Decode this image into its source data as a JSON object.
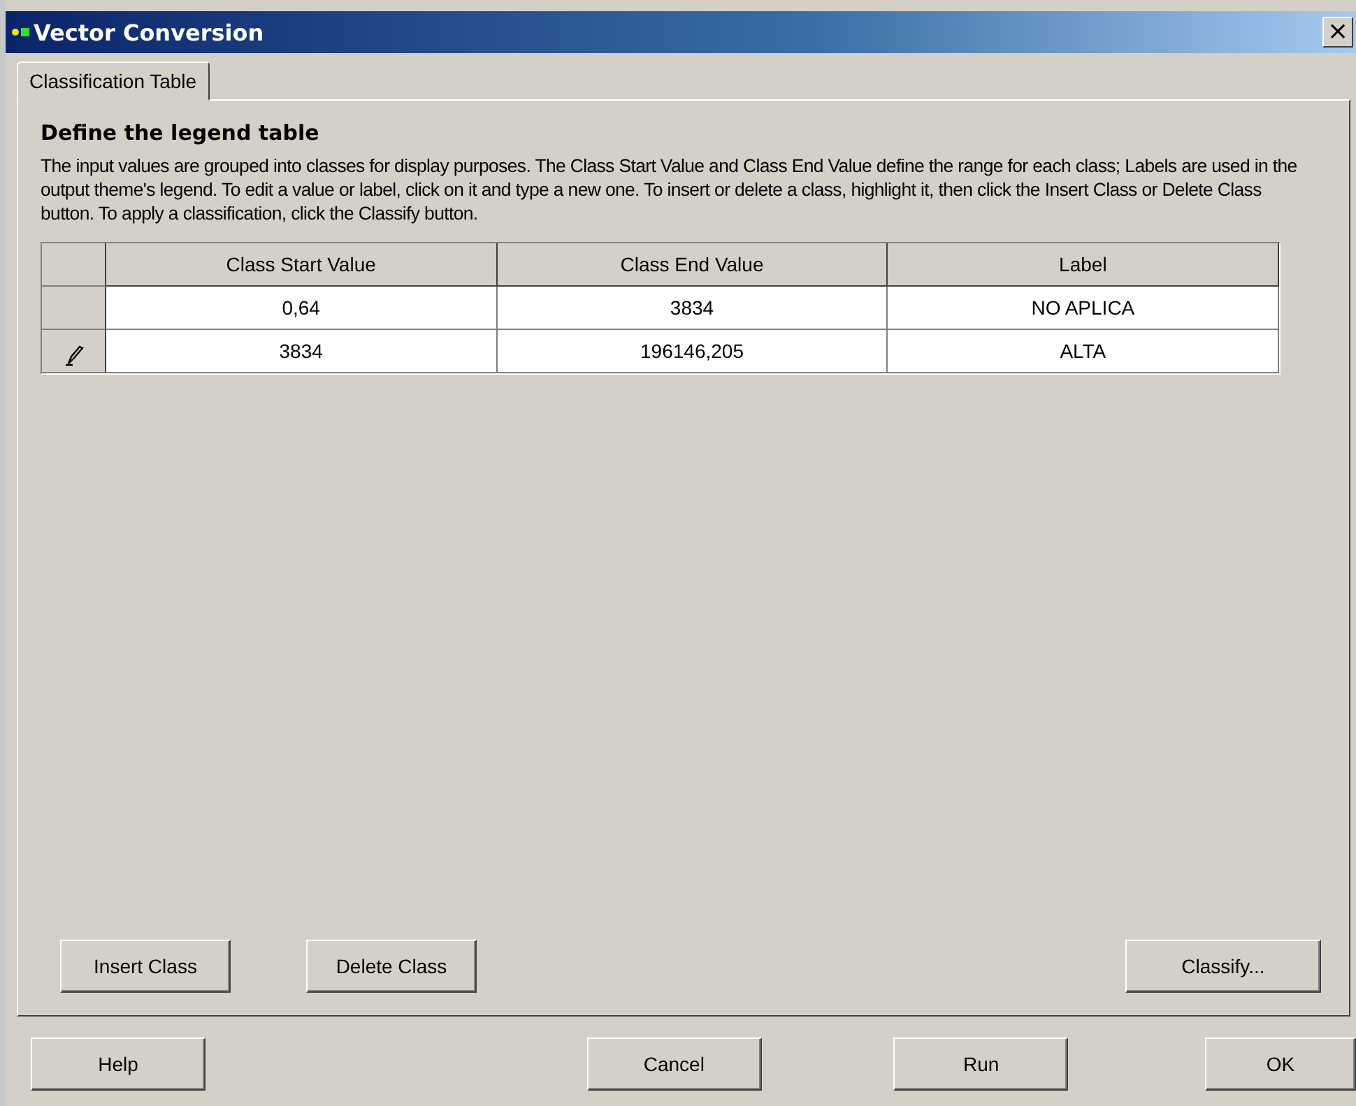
{
  "window": {
    "title": "Vector Conversion",
    "close": "×"
  },
  "tabs": [
    {
      "label": "Classification Table",
      "selected": true
    }
  ],
  "heading": "Define the legend table",
  "description": "The input values are grouped into classes for display purposes. The Class Start Value and Class End Value define the range for each class; Labels are used in the output theme's legend. To edit a value or label, click on it and type a new one. To insert or delete a class, highlight it, then click the Insert Class or Delete Class button. To apply a classification, click the Classify button.",
  "table": {
    "columns": [
      "Class Start Value",
      "Class End Value",
      "Label"
    ],
    "rows": [
      {
        "editing": false,
        "cells": [
          "0,64",
          "3834",
          "NO APLICA"
        ]
      },
      {
        "editing": true,
        "cells": [
          "3834",
          "196146,205",
          "ALTA"
        ]
      }
    ]
  },
  "panel_buttons_left": [
    "Insert Class",
    "Delete Class"
  ],
  "panel_buttons_right": [
    "Classify..."
  ],
  "dialog_buttons": [
    "Help",
    "Cancel",
    "Run",
    "OK"
  ]
}
